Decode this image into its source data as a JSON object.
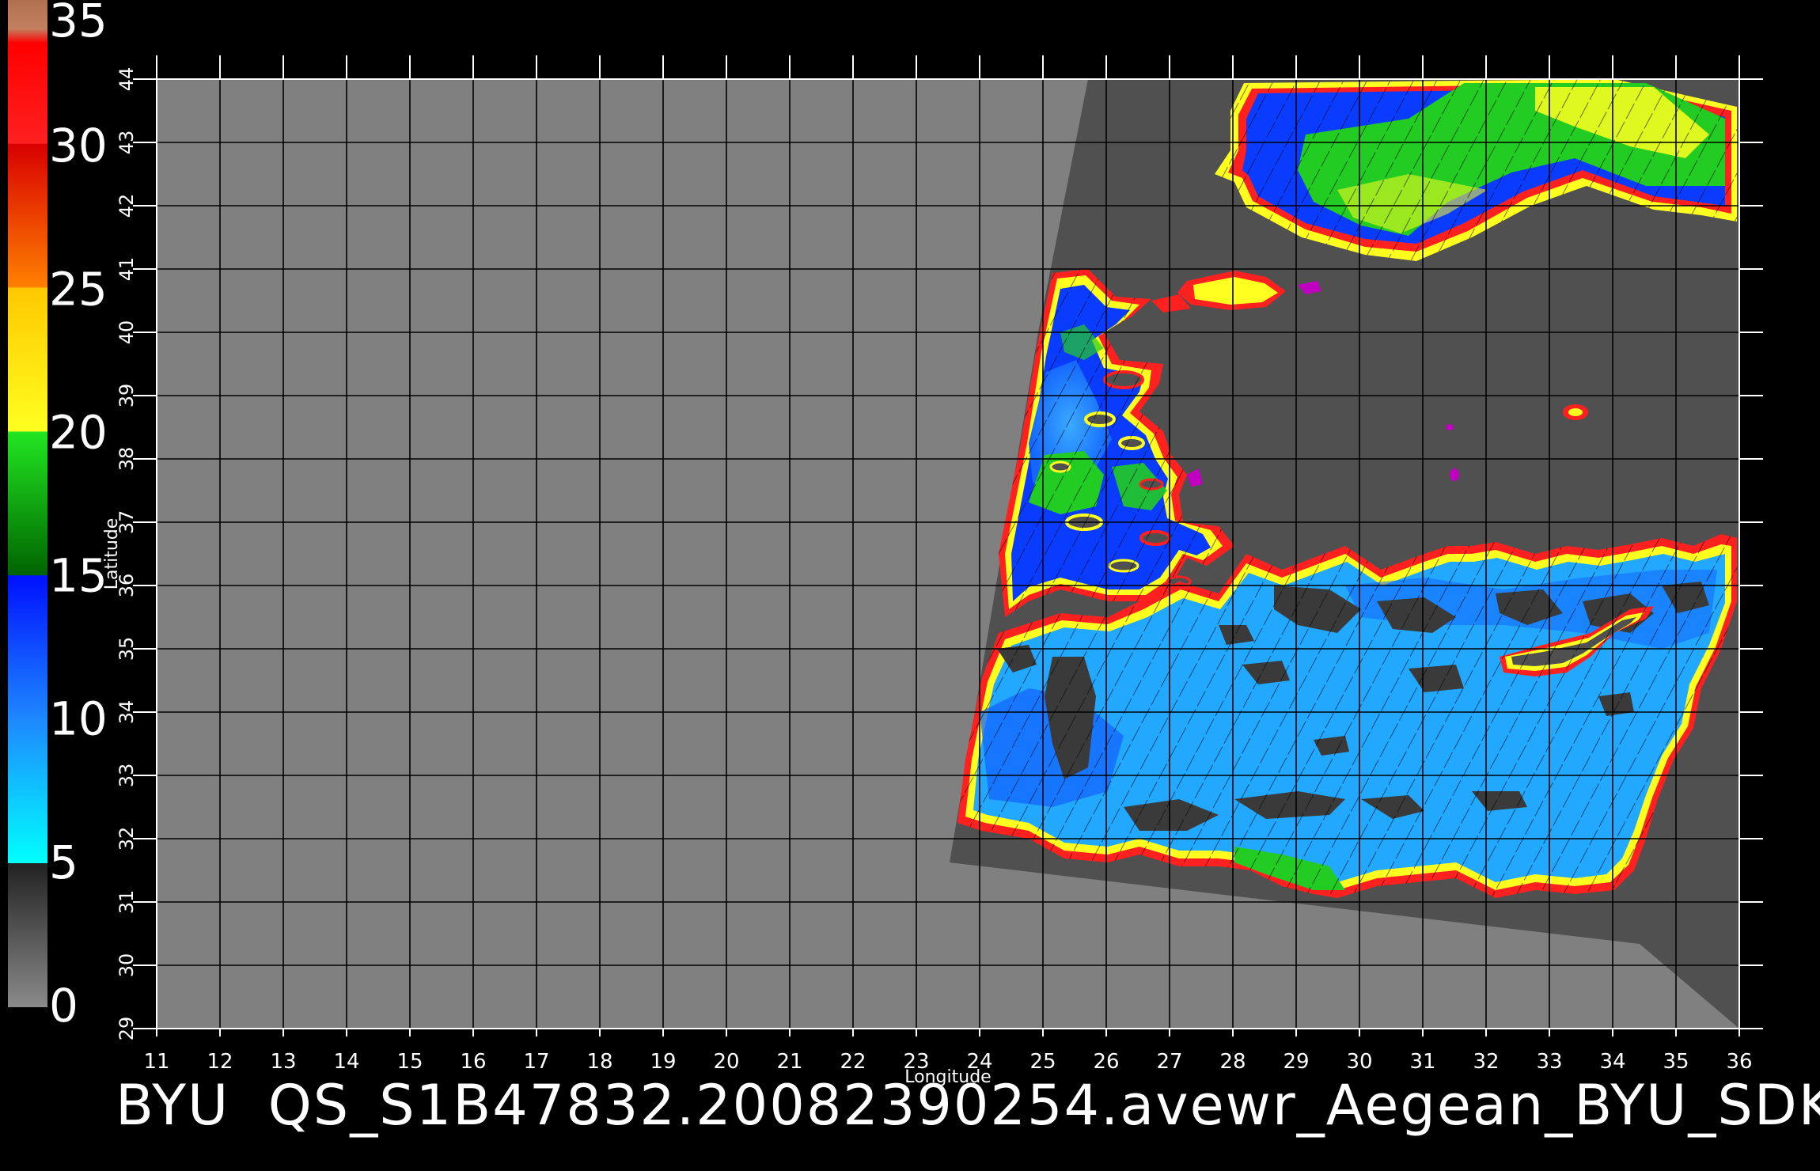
{
  "map": {
    "colorbar": {
      "ticks": [
        "0",
        "5",
        "10",
        "15",
        "20",
        "25",
        "30",
        "35"
      ],
      "stops": [
        {
          "value": 0,
          "color": "#8a8a8a"
        },
        {
          "value": 5,
          "color": "#222222"
        },
        {
          "value": 5.01,
          "color": "#00ffff"
        },
        {
          "value": 10,
          "color": "#1e88ff"
        },
        {
          "value": 15,
          "color": "#0010ff"
        },
        {
          "value": 15.01,
          "color": "#006400"
        },
        {
          "value": 20,
          "color": "#22e622"
        },
        {
          "value": 20.01,
          "color": "#ffff20"
        },
        {
          "value": 25,
          "color": "#ffc800"
        },
        {
          "value": 25.01,
          "color": "#ff8000"
        },
        {
          "value": 30,
          "color": "#d80000"
        },
        {
          "value": 30.01,
          "color": "#ff2020"
        },
        {
          "value": 33.5,
          "color": "#ff0000"
        },
        {
          "value": 34,
          "color": "#c48060"
        },
        {
          "value": 35,
          "color": "#b07050"
        }
      ]
    },
    "x_axis": {
      "label": "Longitude",
      "ticks": [
        "11",
        "12",
        "13",
        "14",
        "15",
        "16",
        "17",
        "18",
        "19",
        "20",
        "21",
        "22",
        "23",
        "24",
        "25",
        "26",
        "27",
        "28",
        "29",
        "30",
        "31",
        "32",
        "33",
        "34",
        "35",
        "36"
      ],
      "range": [
        11,
        36
      ]
    },
    "y_axis": {
      "label": "Latitude",
      "ticks": [
        "29",
        "30",
        "31",
        "32",
        "33",
        "34",
        "35",
        "36",
        "37",
        "38",
        "39",
        "40",
        "41",
        "42",
        "43",
        "44"
      ],
      "range": [
        29,
        44
      ]
    },
    "caption": "BYU  QS_S1B47832.20082390254.avewr_Aegean_BYU_SDK",
    "colors": {
      "background": "#000000",
      "land": "#808080",
      "swath": "#505050",
      "grid": "#000000",
      "ocean_low": "#1e96ff",
      "ocean_mid": "#0a3cff",
      "ocean_high": "#22cc22",
      "coast_yellow": "#ffff20",
      "coast_red": "#ff2020"
    }
  }
}
